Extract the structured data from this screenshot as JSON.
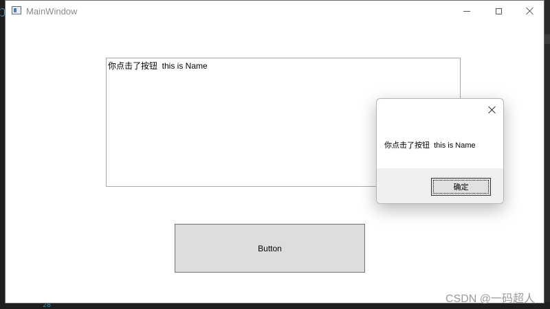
{
  "window": {
    "title": "MainWindow"
  },
  "textbox": {
    "value": "你点击了按钮  this is Name"
  },
  "main_button": {
    "label": "Button"
  },
  "message_box": {
    "text": "你点击了按钮  this is Name",
    "ok_label": "确定"
  },
  "background": {
    "line_number": "28"
  },
  "watermark": {
    "text": "CSDN @一码超人"
  }
}
